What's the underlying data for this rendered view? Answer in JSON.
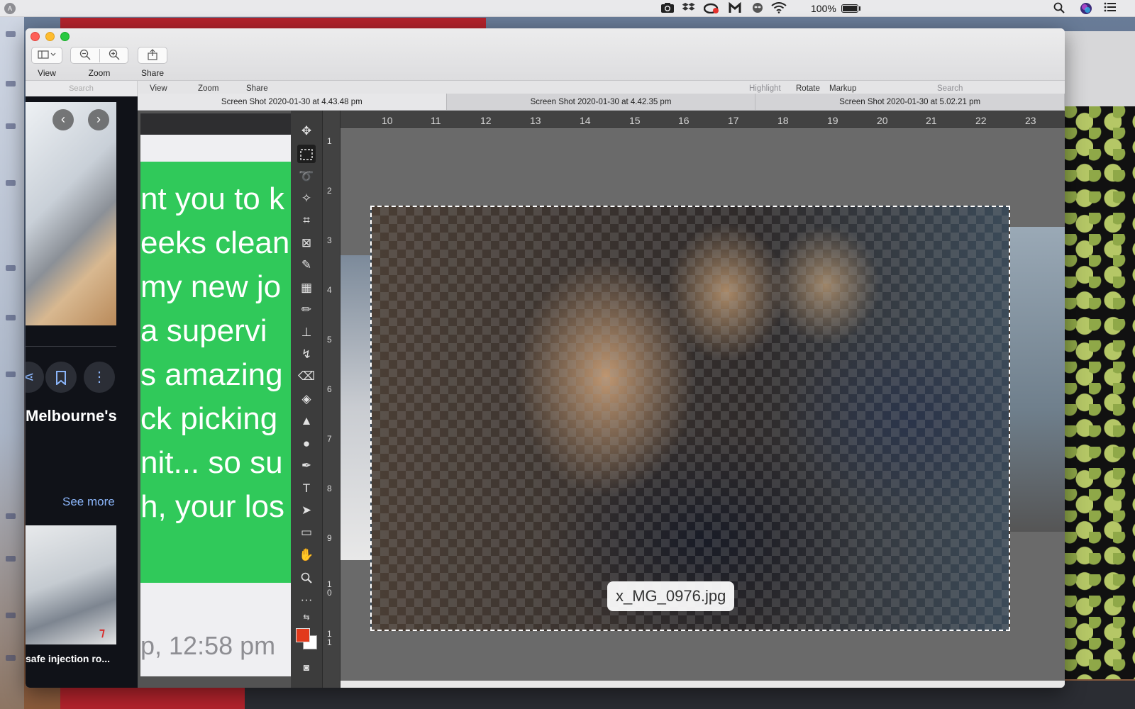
{
  "menubar": {
    "apple_letter": "A",
    "battery_text": "100%",
    "icons": [
      "camera-icon",
      "dropbox-icon",
      "creative-cloud-icon",
      "malwarebytes-icon",
      "alien-icon",
      "wifi-icon",
      "battery-icon",
      "search-icon",
      "siri-icon",
      "control-list-icon"
    ]
  },
  "preview": {
    "toolbar": {
      "view_label": "View",
      "zoom_label": "Zoom",
      "share_label": "Share"
    },
    "subbar": {
      "sidebar_search_placeholder": "Search",
      "view": "View",
      "zoom": "Zoom",
      "share": "Share",
      "highlight": "Highlight",
      "rotate": "Rotate",
      "markup": "Markup",
      "search": "Search"
    },
    "tabs": [
      {
        "label": "Screen Shot 2020-01-30 at 4.43.48 pm",
        "active": true
      },
      {
        "label": "Screen Shot 2020-01-30 at 4.42.35 pm",
        "active": false
      },
      {
        "label": "Screen Shot 2020-01-30 at 5.02.21 pm",
        "active": false
      }
    ]
  },
  "sidebar": {
    "title": "Melbourne's",
    "see_more": "See more",
    "caption": "safe injection ro..."
  },
  "messages": {
    "lines": [
      "nt you to k",
      "eeks clean",
      "my new jo",
      "a supervi",
      "s amazing",
      "ck picking",
      "nit... so su",
      "h, your los"
    ],
    "time": "p, 12:58 pm"
  },
  "photoshop": {
    "ruler_top": [
      "10",
      "11",
      "12",
      "13",
      "14",
      "15",
      "16",
      "17",
      "18",
      "19",
      "20",
      "21",
      "22",
      "23"
    ],
    "ruler_left": [
      "1",
      "2",
      "3",
      "4",
      "5",
      "6",
      "7",
      "8",
      "9",
      "1\n0",
      "1\n1"
    ],
    "filename": "x_MG_0976.jpg",
    "foreground_color": "#e23a1c",
    "background_color": "#ffffff"
  }
}
